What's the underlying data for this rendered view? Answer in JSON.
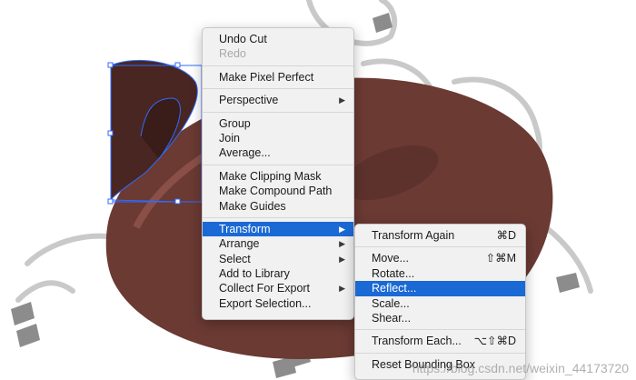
{
  "context_menu": {
    "groups": [
      [
        {
          "label": "Undo Cut",
          "enabled": true
        },
        {
          "label": "Redo",
          "enabled": false
        }
      ],
      [
        {
          "label": "Make Pixel Perfect"
        }
      ],
      [
        {
          "label": "Perspective",
          "submenu": true
        }
      ],
      [
        {
          "label": "Group"
        },
        {
          "label": "Join"
        },
        {
          "label": "Average..."
        }
      ],
      [
        {
          "label": "Make Clipping Mask"
        },
        {
          "label": "Make Compound Path"
        },
        {
          "label": "Make Guides"
        }
      ],
      [
        {
          "label": "Transform",
          "submenu": true,
          "highlighted": true
        },
        {
          "label": "Arrange",
          "submenu": true
        },
        {
          "label": "Select",
          "submenu": true
        },
        {
          "label": "Add to Library"
        },
        {
          "label": "Collect For Export",
          "submenu": true
        },
        {
          "label": "Export Selection..."
        }
      ]
    ]
  },
  "transform_submenu": {
    "groups": [
      [
        {
          "label": "Transform Again",
          "shortcut": "⌘D"
        }
      ],
      [
        {
          "label": "Move...",
          "shortcut": "⇧⌘M"
        },
        {
          "label": "Rotate..."
        },
        {
          "label": "Reflect...",
          "highlighted": true
        },
        {
          "label": "Scale..."
        },
        {
          "label": "Shear..."
        }
      ],
      [
        {
          "label": "Transform Each...",
          "shortcut": "⌥⇧⌘D"
        }
      ],
      [
        {
          "label": "Reset Bounding Box"
        }
      ]
    ]
  },
  "watermark": "https://blog.csdn.net/weixin_44173720",
  "colors": {
    "accent": "#1a69d4",
    "artwork_brown": "#6b3a33",
    "artwork_dark": "#4a2622",
    "selection": "#2f6bff"
  }
}
